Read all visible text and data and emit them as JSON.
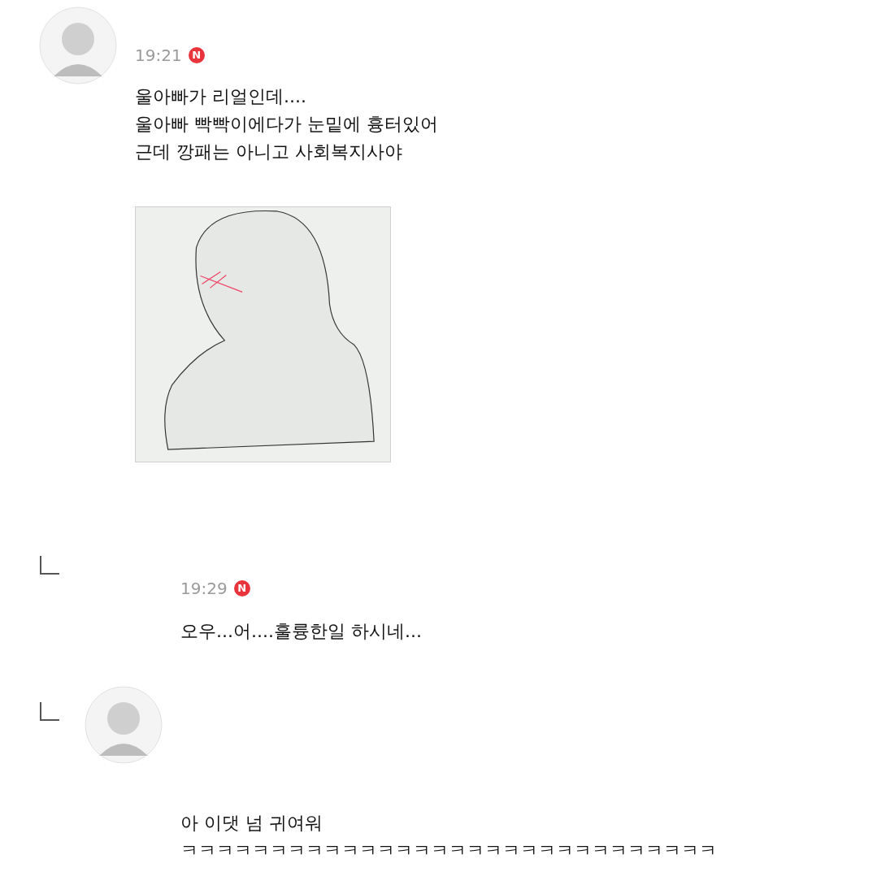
{
  "comments": [
    {
      "kind": "top",
      "avatar": true,
      "time": "19:21",
      "badge": "N",
      "lines": [
        "울아빠가 리얼인데....",
        "울아빠 빡빡이에다가 눈밑에 흉터있어",
        "근데 깡패는 아니고 사회복지사야"
      ]
    },
    {
      "kind": "reply",
      "avatar": false,
      "time": "19:29",
      "badge": "N",
      "lines": [
        "오우...어....훌륭한일 하시네..."
      ]
    },
    {
      "kind": "reply",
      "avatar": true,
      "lines": [
        "아 이댓 넘 귀여워",
        "ㅋㅋㅋㅋㅋㅋㅋㅋㅋㅋㅋㅋㅋㅋㅋㅋㅋㅋㅋㅋㅋㅋㅋㅋㅋㅋㅋㅋㅋㅋ"
      ]
    }
  ]
}
